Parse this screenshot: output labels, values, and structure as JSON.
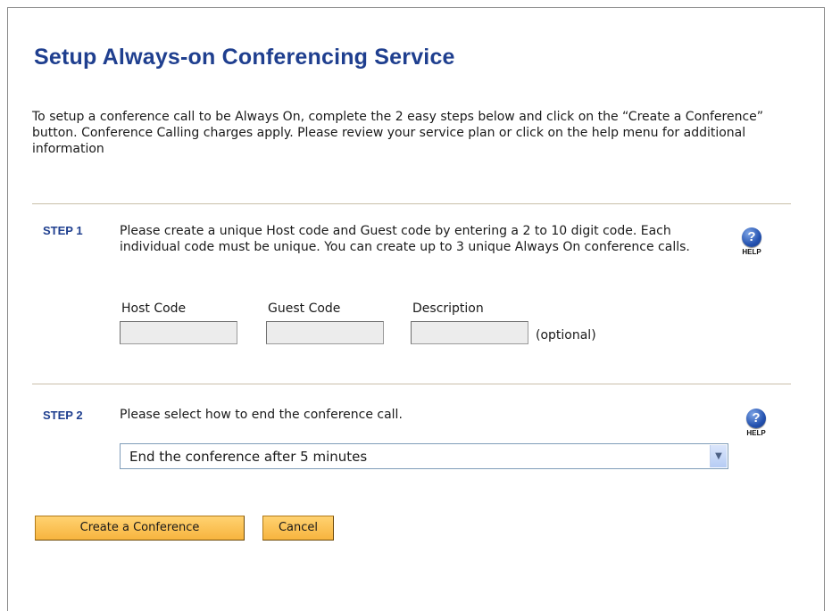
{
  "page": {
    "title": "Setup Always-on Conferencing Service",
    "intro": "To setup a conference call to be Always On, complete the 2 easy steps below and click on the “Create a Conference” button. Conference Calling charges apply. Please review your service plan or click on the help menu for additional information"
  },
  "step1": {
    "label": "STEP 1",
    "text": "Please create a unique Host code and Guest code by entering a 2 to 10 digit code. Each individual code must be unique. You can create up to 3 unique Always On conference calls.",
    "help_label": "HELP",
    "help_icon": "question-circle-icon",
    "host_code_label": "Host Code",
    "host_code_value": "",
    "guest_code_label": "Guest Code",
    "guest_code_value": "",
    "description_label": "Description",
    "description_value": "",
    "optional_text": "(optional)"
  },
  "step2": {
    "label": "STEP 2",
    "text": "Please select how to end the conference call.",
    "help_label": "HELP",
    "help_icon": "question-circle-icon",
    "end_option_selected": "End the conference after 5 minutes"
  },
  "actions": {
    "create_label": "Create a Conference",
    "cancel_label": "Cancel"
  },
  "colors": {
    "title": "#1f3f8f",
    "button": "#f7b43e",
    "divider": "#c9bfa9"
  }
}
